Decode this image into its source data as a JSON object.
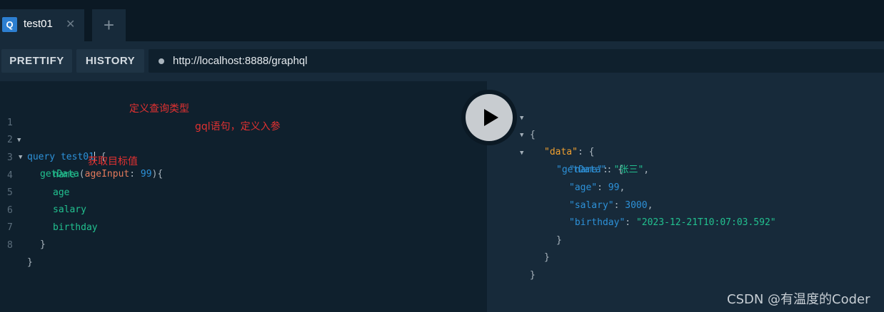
{
  "tabs": [
    {
      "badge": "Q",
      "label": "test01",
      "close": "✕"
    }
  ],
  "add_tab": "+",
  "toolbar": {
    "prettify": "PRETTIFY",
    "history": "HISTORY",
    "url": "http://localhost:8888/graphql"
  },
  "editor": {
    "line_numbers": [
      "1",
      "2",
      "3",
      "4",
      "5",
      "6",
      "7",
      "8"
    ],
    "lines": {
      "l1_kw": "query",
      "l1_name": "test01",
      "l1_brace": "{",
      "l2_field": "getData",
      "l2_open": "(",
      "l2_arg": "ageInput",
      "l2_colon": ":",
      "l2_num": "99",
      "l2_close": "){",
      "l3": "name",
      "l4": "age",
      "l5": "salary",
      "l6": "birthday",
      "l7": "}",
      "l8": "}"
    },
    "notes": {
      "n1": "定义查询类型",
      "n2": "gql语句，定义入参",
      "n3": "获取目标值"
    }
  },
  "result": {
    "open": "{",
    "data_key": "\"data\"",
    "getData_key": "\"getData\"",
    "name_key": "\"name\"",
    "name_val": "\"张三\"",
    "age_key": "\"age\"",
    "age_val": "99",
    "salary_key": "\"salary\"",
    "salary_val": "3000",
    "birthday_key": "\"birthday\"",
    "birthday_val": "\"2023-12-21T10:07:03.592\"",
    "colon_brace": ": {",
    "colon": ": ",
    "comma": ",",
    "close": "}"
  },
  "watermark": "CSDN @有温度的Coder",
  "colors": {
    "background": "#0f202d",
    "accent": "#2d7fd1",
    "field": "#22c08f",
    "argument": "#e57a5b",
    "annotation": "#e03131"
  },
  "icons": {
    "run": "play-icon",
    "close": "close-icon",
    "add": "plus-icon"
  }
}
